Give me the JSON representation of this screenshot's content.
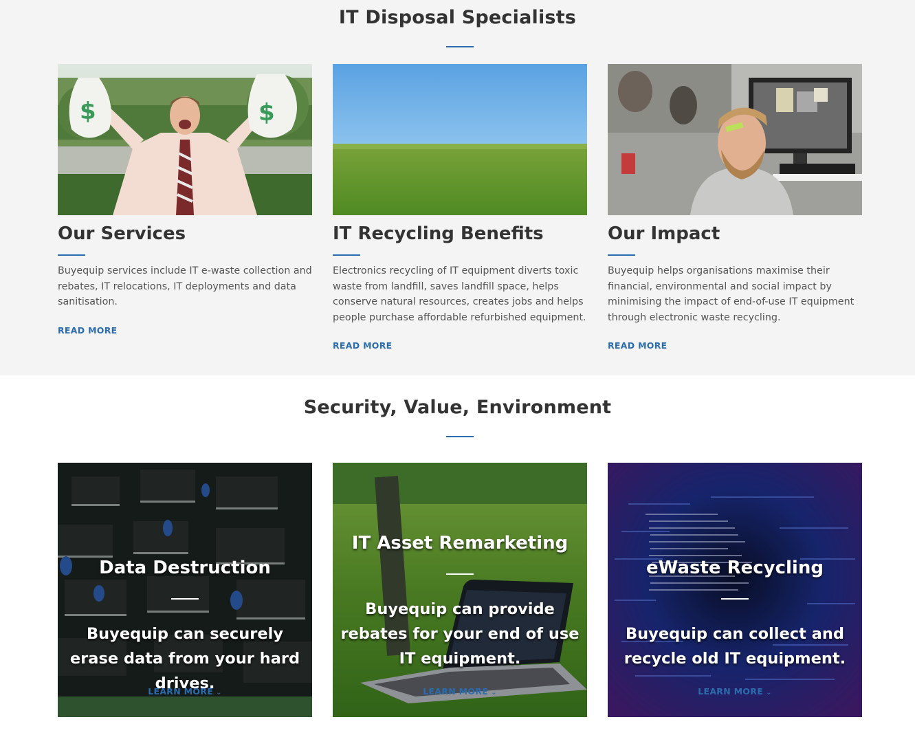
{
  "top": {
    "title": "IT Disposal Specialists",
    "cards": [
      {
        "title": "Our Services",
        "text": "Buyequip services include IT e-waste collection and rebates, IT relocations, IT deployments and data sanitisation.",
        "link": "READ MORE",
        "image": "man-with-money-bags-photo"
      },
      {
        "title": "IT Recycling Benefits",
        "text": "Electronics recycling of IT equipment diverts toxic waste from landfill, saves landfill space, helps conserve natural resources, creates jobs and helps people purchase affordable refurbished equipment.",
        "link": "READ MORE",
        "image": "green-field-blue-sky-photo"
      },
      {
        "title": "Our Impact",
        "text": "Buyequip helps organisations maximise their financial, environmental and social impact by minimising the impact of end-of-use IT equipment through electronic waste recycling.",
        "link": "READ MORE",
        "image": "smiling-man-at-computer-photo"
      }
    ]
  },
  "bottom": {
    "title": "Security, Value, Environment",
    "tiles": [
      {
        "title": "Data Destruction",
        "text": "Buyequip can securely erase data from your hard drives.",
        "link": "LEARN MORE",
        "image": "circuit-board-photo"
      },
      {
        "title": "IT Asset Remarketing",
        "text": "Buyequip can provide rebates for your end of use IT equipment.",
        "link": "LEARN MORE",
        "image": "laptop-on-grass-photo"
      },
      {
        "title": "eWaste Recycling",
        "text": "Buyequip can collect and recycle old IT equipment.",
        "link": "LEARN MORE",
        "image": "code-screen-photo"
      }
    ]
  },
  "colors": {
    "accent": "#2b6cae",
    "top_bg": "#f4f4f4",
    "heading": "#333333",
    "body_text": "#555555"
  },
  "icons": {
    "tile_link_chevron": "chevron-down-icon"
  }
}
